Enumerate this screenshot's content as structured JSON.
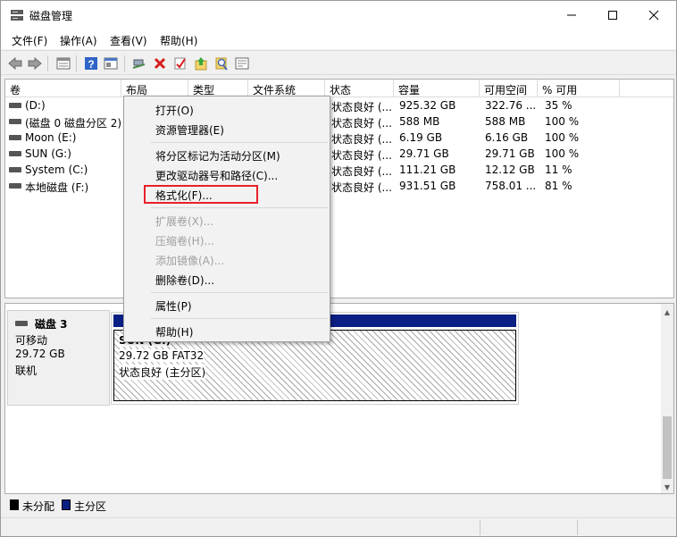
{
  "window": {
    "title": "磁盘管理"
  },
  "menubar": [
    "文件(F)",
    "操作(A)",
    "查看(V)",
    "帮助(H)"
  ],
  "toolbar": {
    "icons": [
      "back-arrow-icon",
      "forward-arrow-icon",
      "volume-list-icon",
      "help-icon",
      "properties-icon",
      "connect-icon",
      "delete-icon",
      "check-icon",
      "folder-up-icon",
      "search-icon",
      "console-icon"
    ],
    "colors": {
      "delete": "#d81e1e",
      "help": "#2f64c8"
    }
  },
  "volume_table": {
    "columns": [
      "卷",
      "布局",
      "类型",
      "文件系统",
      "状态",
      "容量",
      "可用空间",
      "% 可用"
    ],
    "rows": [
      {
        "name": "(D:)",
        "status": "状态良好 (...",
        "capacity": "925.32 GB",
        "free": "322.76 ...",
        "pct": "35 %"
      },
      {
        "name": "(磁盘 0 磁盘分区 2)",
        "status": "状态良好 (...",
        "capacity": "588 MB",
        "free": "588 MB",
        "pct": "100 %"
      },
      {
        "name": "Moon (E:)",
        "status": "状态良好 (...",
        "capacity": "6.19 GB",
        "free": "6.16 GB",
        "pct": "100 %"
      },
      {
        "name": "SUN (G:)",
        "status": "状态良好 (...",
        "capacity": "29.71 GB",
        "free": "29.71 GB",
        "pct": "100 %"
      },
      {
        "name": "System (C:)",
        "status": "状态良好 (...",
        "capacity": "111.21 GB",
        "free": "12.12 GB",
        "pct": "11 %"
      },
      {
        "name": "本地磁盘 (F:)",
        "status": "状态良好 (...",
        "capacity": "931.51 GB",
        "free": "758.01 ...",
        "pct": "81 %"
      }
    ]
  },
  "context_menu": {
    "items": [
      {
        "label": "打开(O)",
        "enabled": true
      },
      {
        "label": "资源管理器(E)",
        "enabled": true
      },
      {
        "label": "将分区标记为活动分区(M)",
        "enabled": true
      },
      {
        "label": "更改驱动器号和路径(C)...",
        "enabled": true
      },
      {
        "label": "格式化(F)...",
        "enabled": true,
        "highlighted": true
      },
      {
        "label": "扩展卷(X)...",
        "enabled": false
      },
      {
        "label": "压缩卷(H)...",
        "enabled": false
      },
      {
        "label": "添加镜像(A)...",
        "enabled": false
      },
      {
        "label": "删除卷(D)...",
        "enabled": true
      },
      {
        "label": "属性(P)",
        "enabled": true
      },
      {
        "label": "帮助(H)",
        "enabled": true
      }
    ],
    "highlight_color": "#e8202a"
  },
  "disk_graph": {
    "disk": {
      "name": "磁盘 3",
      "type": "可移动",
      "size": "29.72 GB",
      "state": "联机"
    },
    "partition": {
      "name_partial": "SUN (G:)",
      "size_fs": "29.72 GB FAT32",
      "status": "状态良好 (主分区)",
      "header_color": "#0a1f84"
    }
  },
  "legend": [
    {
      "label": "未分配",
      "color": "#000000"
    },
    {
      "label": "主分区",
      "color": "#0a1f84"
    }
  ]
}
